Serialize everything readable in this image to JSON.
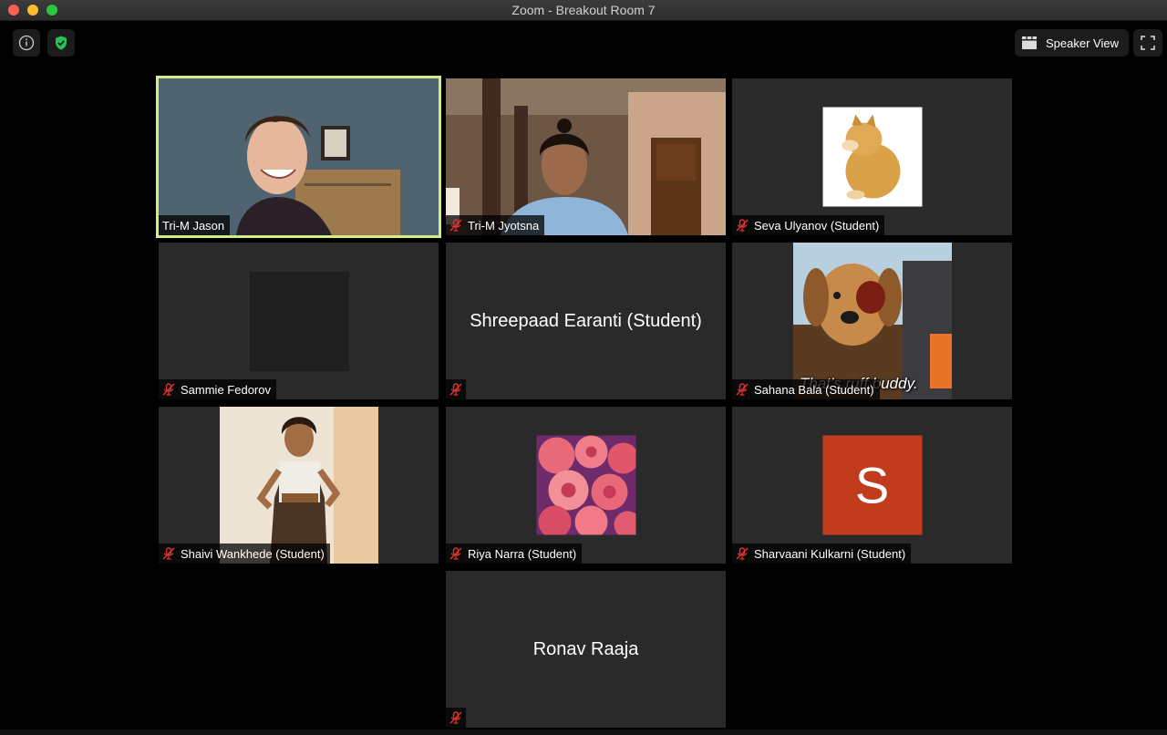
{
  "window": {
    "title": "Zoom - Breakout Room 7"
  },
  "toolbar": {
    "speaker_view_label": "Speaker View",
    "info_icon": "info-icon",
    "shield_icon": "shield-check-icon",
    "fullscreen_icon": "fullscreen-icon"
  },
  "colors": {
    "active_speaker_border": "#d2ec86",
    "muted_mic": "#e0322f",
    "avatar_letter_bg": "#c23b1c"
  },
  "participants": [
    {
      "name": "Tri-M Jason",
      "muted": false,
      "active": true,
      "display": "video"
    },
    {
      "name": "Tri-M Jyotsna",
      "muted": true,
      "display": "video"
    },
    {
      "name": "Seva Ulyanov (Student)",
      "muted": true,
      "display": "profile-image"
    },
    {
      "name": "Sammie Fedorov",
      "muted": true,
      "display": "blank-image"
    },
    {
      "name": "Shreepaad Earanti (Student)",
      "muted": true,
      "display": "name-only",
      "name_bar": ""
    },
    {
      "name": "Sahana Bala (Student)",
      "muted": true,
      "display": "profile-image",
      "caption": "That's ruff buddy."
    },
    {
      "name": "Shaivi Wankhede (Student)",
      "muted": true,
      "display": "profile-image"
    },
    {
      "name": "Riya Narra (Student)",
      "muted": true,
      "display": "profile-image"
    },
    {
      "name": "Sharvaani Kulkarni (Student)",
      "muted": true,
      "display": "letter-avatar",
      "letter": "S"
    },
    {
      "name": "Ronav Raaja",
      "muted": true,
      "display": "name-only",
      "name_bar": ""
    }
  ]
}
